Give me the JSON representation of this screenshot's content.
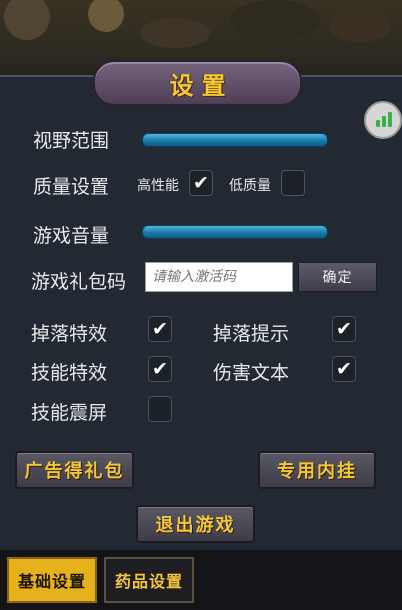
{
  "title": "设置",
  "settings": {
    "view_range": {
      "label": "视野范围",
      "level": 1.0
    },
    "quality": {
      "label": "质量设置",
      "options": [
        {
          "label": "高性能",
          "checked": true
        },
        {
          "label": "低质量",
          "checked": false
        }
      ]
    },
    "volume": {
      "label": "游戏音量",
      "level": 1.0
    },
    "gift_code": {
      "label": "游戏礼包码",
      "placeholder": "请输入激活码",
      "confirm_label": "确定"
    },
    "toggles": [
      {
        "label": "掉落特效",
        "checked": true
      },
      {
        "label": "掉落提示",
        "checked": true
      },
      {
        "label": "技能特效",
        "checked": true
      },
      {
        "label": "伤害文本",
        "checked": true
      },
      {
        "label": "技能震屏",
        "checked": false
      }
    ]
  },
  "buttons": {
    "ad_gift": "广告得礼包",
    "plugin": "专用内挂",
    "exit": "退出游戏"
  },
  "tabs": [
    {
      "label": "基础设置",
      "active": true
    },
    {
      "label": "药品设置",
      "active": false
    }
  ],
  "icons": {
    "signal": "signal-bars-icon",
    "check": "check-icon"
  },
  "colors": {
    "accent_gold": "#f4c63a",
    "slider_blue": "#1a79a8",
    "tab_active": "#e6b21c"
  }
}
